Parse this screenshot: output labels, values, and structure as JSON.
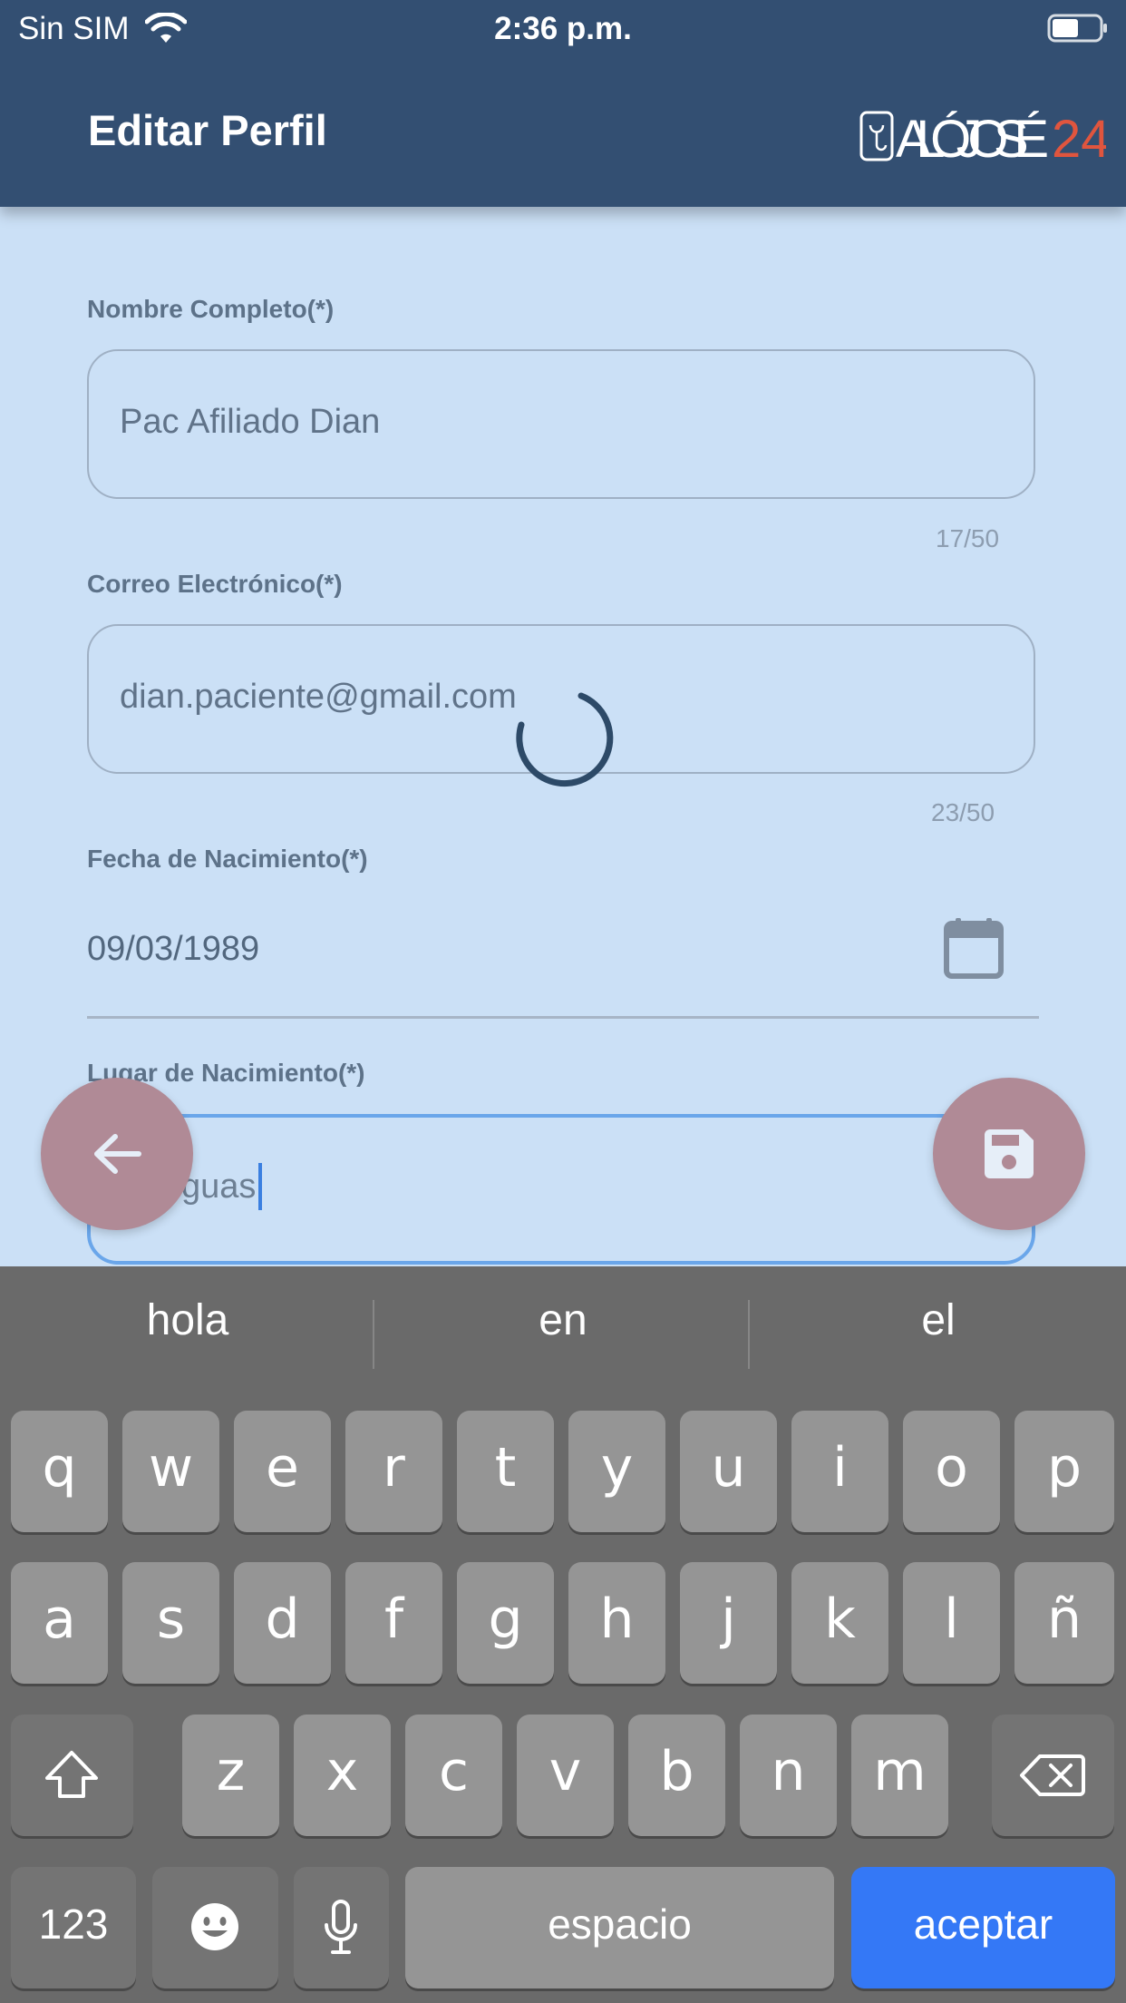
{
  "status_bar": {
    "carrier": "Sin SIM",
    "time": "2:36 p.m."
  },
  "app_bar": {
    "title": "Editar Perfil",
    "logo_text": "ALÓJOSÉ24"
  },
  "form": {
    "nombre": {
      "label": "Nombre Completo(*)",
      "value": "Pac Afiliado Dian",
      "counter": "17/50"
    },
    "correo": {
      "label": "Correo Electrónico(*)",
      "value": "dian.paciente@gmail.com",
      "counter": "23/50"
    },
    "fecha": {
      "label": "Fecha de Nacimiento(*)",
      "value": "09/03/1989"
    },
    "lugar": {
      "label": "Lugar de Nacimiento(*)",
      "value": "guas"
    }
  },
  "keyboard": {
    "suggestions": [
      "hola",
      "en",
      "el"
    ],
    "row1": [
      "q",
      "w",
      "e",
      "r",
      "t",
      "y",
      "u",
      "i",
      "o",
      "p"
    ],
    "row2": [
      "a",
      "s",
      "d",
      "f",
      "g",
      "h",
      "j",
      "k",
      "l",
      "ñ"
    ],
    "row3": [
      "z",
      "x",
      "c",
      "v",
      "b",
      "n",
      "m"
    ],
    "numbers_label": "123",
    "space_label": "espacio",
    "return_label": "aceptar"
  },
  "icons": {
    "back": "arrow-left-icon",
    "save": "floppy-disk-icon",
    "calendar": "calendar-icon",
    "shift": "shift-arrow-icon",
    "delete": "backspace-icon",
    "emoji": "emoji-icon",
    "mic": "microphone-icon"
  },
  "colors": {
    "app_bar": "#334f72",
    "background": "#cbe0f6",
    "fab": "#b08a96",
    "accept": "#3478f6",
    "logo_accent": "#e0553e"
  }
}
